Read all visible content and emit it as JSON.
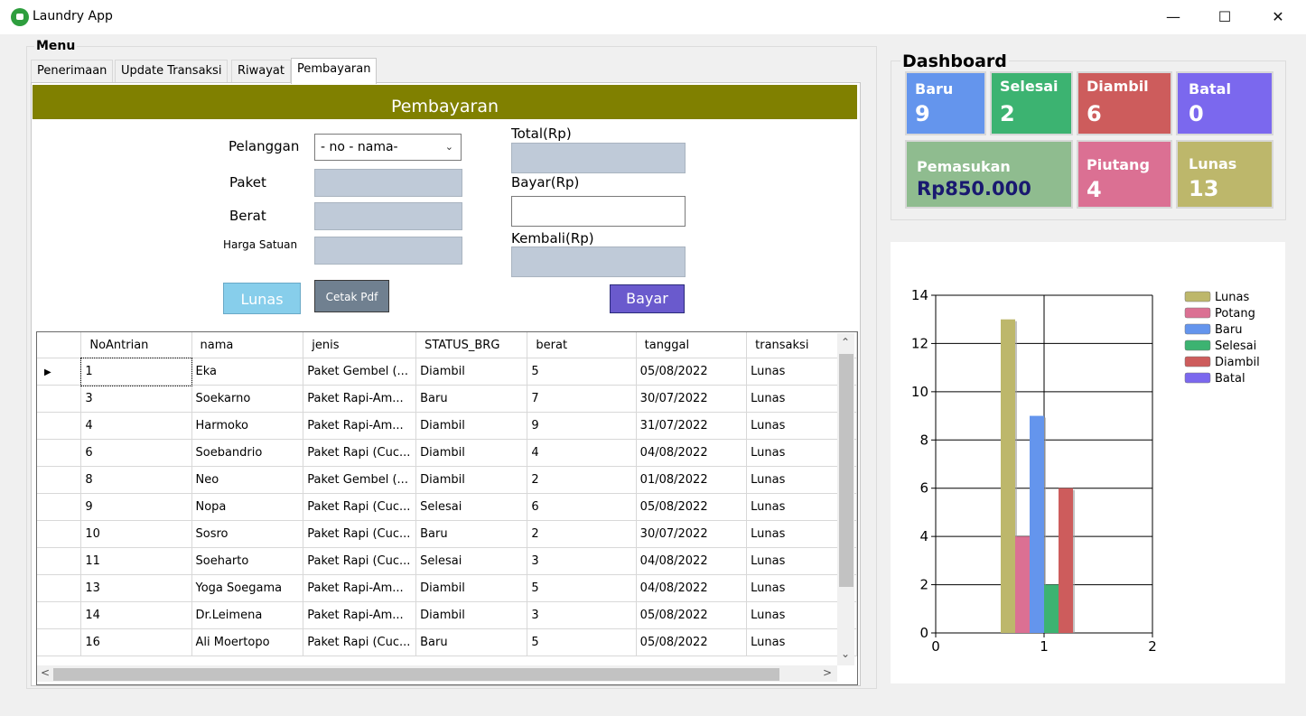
{
  "window": {
    "title": "Laundry App",
    "minimize": "—",
    "maximize": "☐",
    "close": "✕"
  },
  "menu": {
    "legend": "Menu",
    "tabs": [
      "Penerimaan",
      "Update Transaksi",
      "Riwayat",
      "Pembayaran"
    ],
    "active_tab": "Pembayaran"
  },
  "form": {
    "header": "Pembayaran",
    "pelanggan_label": "Pelanggan",
    "pelanggan_value": "- no - nama-",
    "paket_label": "Paket",
    "berat_label": "Berat",
    "harga_label": "Harga Satuan",
    "total_label": "Total(Rp)",
    "bayar_label": "Bayar(Rp)",
    "kembali_label": "Kembali(Rp)",
    "lunas_button": "Lunas",
    "cetak_button": "Cetak Pdf",
    "bayar_button": "Bayar"
  },
  "grid": {
    "columns": [
      "NoAntrian",
      "nama",
      "jenis",
      "STATUS_BRG",
      "berat",
      "tanggal",
      "transaksi"
    ],
    "rows": [
      [
        "1",
        "Eka",
        "Paket Gembel (...",
        "Diambil",
        "5",
        "05/08/2022",
        "Lunas"
      ],
      [
        "3",
        "Soekarno",
        "Paket Rapi-Am...",
        "Baru",
        "7",
        "30/07/2022",
        "Lunas"
      ],
      [
        "4",
        "Harmoko",
        "Paket Rapi-Am...",
        "Diambil",
        "9",
        "31/07/2022",
        "Lunas"
      ],
      [
        "6",
        "Soebandrio",
        "Paket Rapi (Cuc...",
        "Diambil",
        "4",
        "04/08/2022",
        "Lunas"
      ],
      [
        "8",
        "Neo",
        "Paket Gembel (...",
        "Diambil",
        "2",
        "01/08/2022",
        "Lunas"
      ],
      [
        "9",
        "Nopa",
        "Paket Rapi (Cuc...",
        "Selesai",
        "6",
        "05/08/2022",
        "Lunas"
      ],
      [
        "10",
        "Sosro",
        "Paket Rapi (Cuc...",
        "Baru",
        "2",
        "30/07/2022",
        "Lunas"
      ],
      [
        "11",
        "Soeharto",
        "Paket Rapi (Cuc...",
        "Selesai",
        "3",
        "04/08/2022",
        "Lunas"
      ],
      [
        "13",
        "Yoga Soegama",
        "Paket Rapi-Am...",
        "Diambil",
        "5",
        "04/08/2022",
        "Lunas"
      ],
      [
        "14",
        "Dr.Leimena",
        "Paket Rapi-Am...",
        "Diambil",
        "3",
        "05/08/2022",
        "Lunas"
      ],
      [
        "16",
        "Ali Moertopo",
        "Paket Rapi (Cuc...",
        "Baru",
        "5",
        "05/08/2022",
        "Lunas"
      ]
    ],
    "selected_row": 0
  },
  "dashboard": {
    "legend": "Dashboard",
    "cards": [
      {
        "label": "Baru",
        "value": "9",
        "color": "#6495ed"
      },
      {
        "label": "Selesai",
        "value": "2",
        "color": "#3cb371"
      },
      {
        "label": "Diambil",
        "value": "6",
        "color": "#cd5c5c"
      },
      {
        "label": "Batal",
        "value": "0",
        "color": "#7b68ee"
      },
      {
        "label": "Pemasukan",
        "value": "Rp850.000",
        "color": "#8fbc8f",
        "value_color": "#191970"
      },
      {
        "label": "Piutang",
        "value": "4",
        "color": "#db7093"
      },
      {
        "label": "Lunas",
        "value": "13",
        "color": "#bdb76b"
      }
    ]
  },
  "chart_data": {
    "type": "bar",
    "x_ticks": [
      "0",
      "1",
      "2"
    ],
    "xlim": [
      0,
      2
    ],
    "ylim": [
      0,
      14
    ],
    "y_ticks": [
      "0",
      "2",
      "4",
      "6",
      "8",
      "10",
      "12",
      "14"
    ],
    "grid": true,
    "legend_position": "top-right",
    "series": [
      {
        "name": "Lunas",
        "value": 13,
        "color": "#bdb76b"
      },
      {
        "name": "Potang",
        "value": 4,
        "color": "#db7093"
      },
      {
        "name": "Baru",
        "value": 9,
        "color": "#6495ed"
      },
      {
        "name": "Selesai",
        "value": 2,
        "color": "#3cb371"
      },
      {
        "name": "Diambil",
        "value": 6,
        "color": "#cd5c5c"
      },
      {
        "name": "Batal",
        "value": 0,
        "color": "#7b68ee"
      }
    ]
  }
}
